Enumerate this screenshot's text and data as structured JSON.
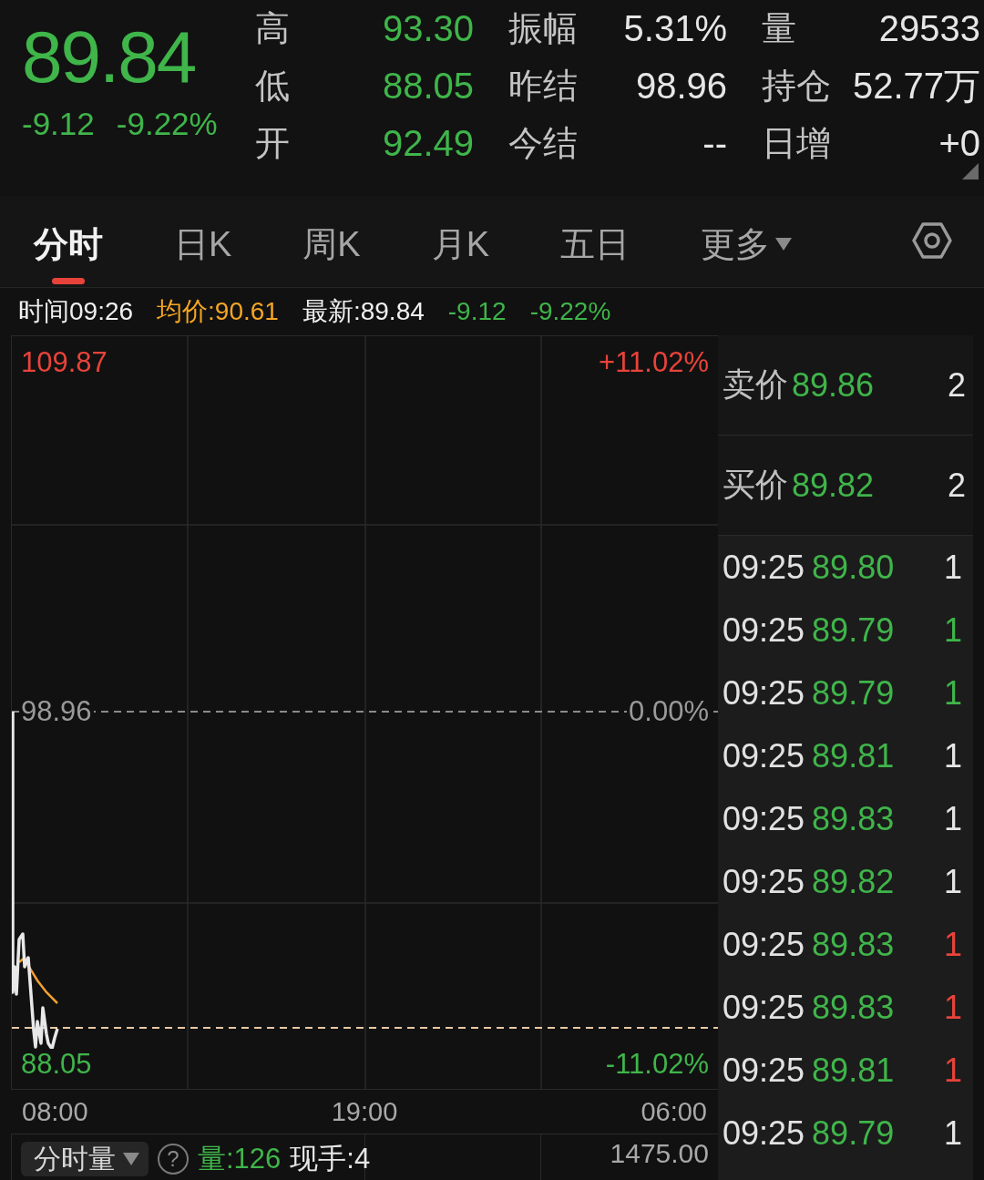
{
  "quote": {
    "price": "89.84",
    "change": "-9.12",
    "change_percent": "-9.22%",
    "color": "#3fb54a"
  },
  "stats": [
    {
      "label": "高",
      "value": "93.30",
      "color": "#3fb54a"
    },
    {
      "label": "振幅",
      "value": "5.31%",
      "color": "#e6e6e6"
    },
    {
      "label": "量",
      "value": "29533",
      "color": "#e6e6e6"
    },
    {
      "label": "低",
      "value": "88.05",
      "color": "#3fb54a"
    },
    {
      "label": "昨结",
      "value": "98.96",
      "color": "#e6e6e6"
    },
    {
      "label": "持仓",
      "value": "52.77万",
      "color": "#e6e6e6"
    },
    {
      "label": "开",
      "value": "92.49",
      "color": "#3fb54a"
    },
    {
      "label": "今结",
      "value": "--",
      "color": "#e6e6e6"
    },
    {
      "label": "日增",
      "value": "+0",
      "color": "#e6e6e6"
    }
  ],
  "tabs": [
    {
      "label": "分时",
      "selected": true,
      "kind": "tab"
    },
    {
      "label": "日K",
      "selected": false,
      "kind": "tab"
    },
    {
      "label": "周K",
      "selected": false,
      "kind": "tab"
    },
    {
      "label": "月K",
      "selected": false,
      "kind": "tab"
    },
    {
      "label": "五日",
      "selected": false,
      "kind": "tab"
    },
    {
      "label": "更多",
      "selected": false,
      "kind": "dropdown"
    }
  ],
  "info_line": [
    {
      "text": "时间09:26",
      "color": "#f0f0f0"
    },
    {
      "text": "均价:90.61",
      "color": "#f5a623"
    },
    {
      "text": "最新:89.84",
      "color": "#f0f0f0"
    },
    {
      "text": "-9.12",
      "color": "#3fb54a"
    },
    {
      "text": "-9.22%",
      "color": "#3fb54a"
    }
  ],
  "chart": {
    "price_labels": [
      {
        "text": "109.87",
        "color": "#e8433a"
      },
      {
        "text": "98.96",
        "color": "#9a9a9a"
      },
      {
        "text": "88.05",
        "color": "#3fb54a"
      }
    ],
    "percent_labels": [
      {
        "text": "+11.02%",
        "color": "#e8433a"
      },
      {
        "text": "0.00%",
        "color": "#9a9a9a"
      },
      {
        "text": "-11.02%",
        "color": "#3fb54a"
      }
    ],
    "time_labels": [
      "08:00",
      "19:00",
      "06:00"
    ]
  },
  "volume_panel": {
    "selector": "分时量",
    "help": "?",
    "volume": "量:126",
    "current_hand": "现手:4",
    "scale": "1475.00"
  },
  "order_book": [
    {
      "label": "卖价",
      "price": "89.86",
      "volume": "2"
    },
    {
      "label": "买价",
      "price": "89.82",
      "volume": "2"
    }
  ],
  "trades": [
    {
      "time": "09:25",
      "price": "89.80",
      "volume": "1",
      "color": "#e6e6e6"
    },
    {
      "time": "09:25",
      "price": "89.79",
      "volume": "1",
      "color": "#3fb54a"
    },
    {
      "time": "09:25",
      "price": "89.79",
      "volume": "1",
      "color": "#3fb54a"
    },
    {
      "time": "09:25",
      "price": "89.81",
      "volume": "1",
      "color": "#e6e6e6"
    },
    {
      "time": "09:25",
      "price": "89.83",
      "volume": "1",
      "color": "#e6e6e6"
    },
    {
      "time": "09:25",
      "price": "89.82",
      "volume": "1",
      "color": "#e6e6e6"
    },
    {
      "time": "09:25",
      "price": "89.83",
      "volume": "1",
      "color": "#e8433a"
    },
    {
      "time": "09:25",
      "price": "89.83",
      "volume": "1",
      "color": "#e8433a"
    },
    {
      "time": "09:25",
      "price": "89.81",
      "volume": "1",
      "color": "#e8433a"
    },
    {
      "time": "09:25",
      "price": "89.79",
      "volume": "1",
      "color": "#e6e6e6"
    }
  ]
}
